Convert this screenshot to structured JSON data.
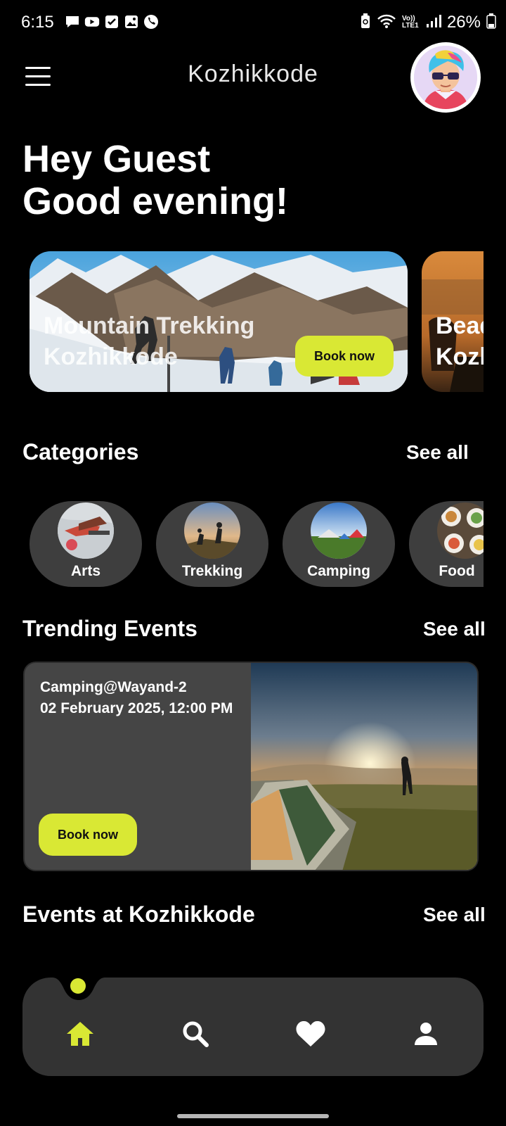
{
  "status_bar": {
    "time": "6:15",
    "battery": "26%",
    "network_label": "Vo)) LTE1"
  },
  "header": {
    "title": "Kozhikkode"
  },
  "greeting": {
    "line1": "Hey Guest",
    "line2": "Good evening!"
  },
  "hero": {
    "cards": [
      {
        "title_line1": "Mountain Trekking",
        "title_line2": "Kozhikkode",
        "button": "Book now"
      },
      {
        "title_line1": "Bead",
        "title_line2": "Kozl"
      }
    ]
  },
  "categories": {
    "title": "Categories",
    "see_all": "See all",
    "items": [
      {
        "label": "Arts"
      },
      {
        "label": "Trekking"
      },
      {
        "label": "Camping"
      },
      {
        "label": "Food"
      }
    ]
  },
  "trending": {
    "title": "Trending Events",
    "see_all": "See all",
    "event": {
      "name": "Camping@Wayand-2",
      "datetime": "02 February 2025, 12:00 PM",
      "button": "Book now"
    }
  },
  "local_events": {
    "title": "Events at Kozhikkode",
    "see_all": "See all"
  },
  "bottom_nav": {
    "items": [
      {
        "icon": "home-icon",
        "active": true
      },
      {
        "icon": "search-icon",
        "active": false
      },
      {
        "icon": "heart-icon",
        "active": false
      },
      {
        "icon": "user-icon",
        "active": false
      }
    ]
  },
  "colors": {
    "accent": "#d9e834",
    "background": "#000000",
    "card": "#454545",
    "nav": "#333333"
  }
}
